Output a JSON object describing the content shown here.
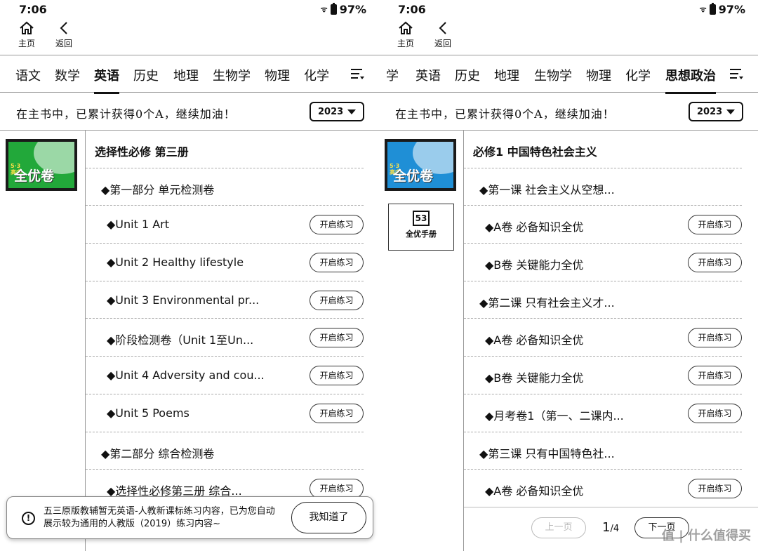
{
  "left": {
    "status": {
      "time": "7:06",
      "battery": "97%"
    },
    "toolbar": {
      "home_label": "主页",
      "back_label": "返回"
    },
    "tabs": [
      "语文",
      "数学",
      "英语",
      "历史",
      "地理",
      "生物学",
      "物理",
      "化学"
    ],
    "active_tab": "英语",
    "banner": {
      "text": "在主书中，已累计获得0个A，继续加油！",
      "year": "2023"
    },
    "cover_text": "全优卷",
    "cover_small": "5·3\n高中",
    "cover_color": "#22a83a",
    "list": [
      {
        "label": "选择性必修 第三册",
        "type": "head"
      },
      {
        "label": "◆第一部分 单元检测卷",
        "type": "l1"
      },
      {
        "label": "◆Unit 1 Art",
        "type": "l2",
        "button": "开启练习"
      },
      {
        "label": "◆Unit 2 Healthy lifestyle",
        "type": "l2",
        "button": "开启练习"
      },
      {
        "label": "◆Unit 3 Environmental pr...",
        "type": "l2",
        "button": "开启练习"
      },
      {
        "label": "◆阶段检测卷（Unit 1至Un...",
        "type": "l2",
        "button": "开启练习"
      },
      {
        "label": "◆Unit 4 Adversity and cou...",
        "type": "l2",
        "button": "开启练习"
      },
      {
        "label": "◆Unit 5 Poems",
        "type": "l2",
        "button": "开启练习"
      },
      {
        "label": "◆第二部分 综合检测卷",
        "type": "l1"
      },
      {
        "label": "◆选择性必修第三册 综合...",
        "type": "l2",
        "button": "开启练习"
      }
    ],
    "toast": {
      "message": "五三原版教辅暂无英语-人教新课标练习内容，已为您自动展示较为通用的人教版（2019）练习内容~",
      "button": "我知道了"
    }
  },
  "right": {
    "status": {
      "time": "7:06",
      "battery": "97%"
    },
    "toolbar": {
      "home_label": "主页",
      "back_label": "返回"
    },
    "tabs": [
      "学",
      "英语",
      "历史",
      "地理",
      "生物学",
      "物理",
      "化学",
      "思想政治"
    ],
    "active_tab": "思想政治",
    "banner": {
      "text": "在主书中，已累计获得0个A，继续加油！",
      "year": "2023"
    },
    "cover_text": "全优卷",
    "cover_small": "5·3\n高中",
    "cover_color": "#1f8fd6",
    "handbook_label": "全优手册",
    "handbook_logo": "53",
    "list": [
      {
        "label": "必修1 中国特色社会主义",
        "type": "head"
      },
      {
        "label": "◆第一课 社会主义从空想...",
        "type": "l1"
      },
      {
        "label": "◆A卷 必备知识全优",
        "type": "l2",
        "button": "开启练习"
      },
      {
        "label": "◆B卷 关键能力全优",
        "type": "l2",
        "button": "开启练习"
      },
      {
        "label": "◆第二课 只有社会主义才...",
        "type": "l1"
      },
      {
        "label": "◆A卷 必备知识全优",
        "type": "l2",
        "button": "开启练习"
      },
      {
        "label": "◆B卷 关键能力全优",
        "type": "l2",
        "button": "开启练习"
      },
      {
        "label": "◆月考卷1（第一、二课内...",
        "type": "l2",
        "button": "开启练习"
      },
      {
        "label": "◆第三课 只有中国特色社...",
        "type": "l1"
      },
      {
        "label": "◆A卷 必备知识全优",
        "type": "l2",
        "button": "开启练习"
      }
    ],
    "pager": {
      "prev": "上一页",
      "next": "下一页",
      "current": "1",
      "total": "/4"
    }
  },
  "watermark": "值 | 什么值得买"
}
